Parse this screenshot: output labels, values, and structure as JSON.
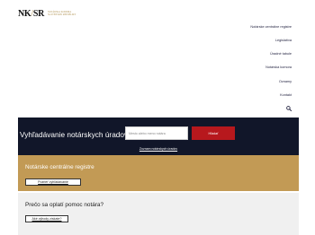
{
  "logo": {
    "mark_letters": "NK",
    "mark_slash": "/",
    "mark_suffix": "SR",
    "text_line1": "Notárska komora",
    "text_line2": "Slovenskej republiky"
  },
  "nav": {
    "items": [
      {
        "label": "Notárske centrálne registre"
      },
      {
        "label": "Legislatíva"
      },
      {
        "label": "Úradné tabule"
      },
      {
        "label": "Notárska komora"
      },
      {
        "label": "Oznamy"
      },
      {
        "label": "Kontakt"
      }
    ],
    "search_icon": "search-icon"
  },
  "hero": {
    "title": "Vyhľadávanie notárskych úradov v SR",
    "search_placeholder": "Mesto alebo meno notára",
    "search_button": "Hľadať",
    "list_link": "Zoznam notárskych úradov"
  },
  "cards": [
    {
      "title": "Notárske centrálne registre",
      "button": "Pozrieť vyhľadávanie"
    },
    {
      "title": "Prečo sa oplatí pomoc notára?",
      "button": "Aké výhody získate?"
    }
  ],
  "colors": {
    "hero_bg": "#111629",
    "accent_red": "#b7181d",
    "accent_gold": "#c29a55",
    "card_gray": "#f0f0f0"
  }
}
